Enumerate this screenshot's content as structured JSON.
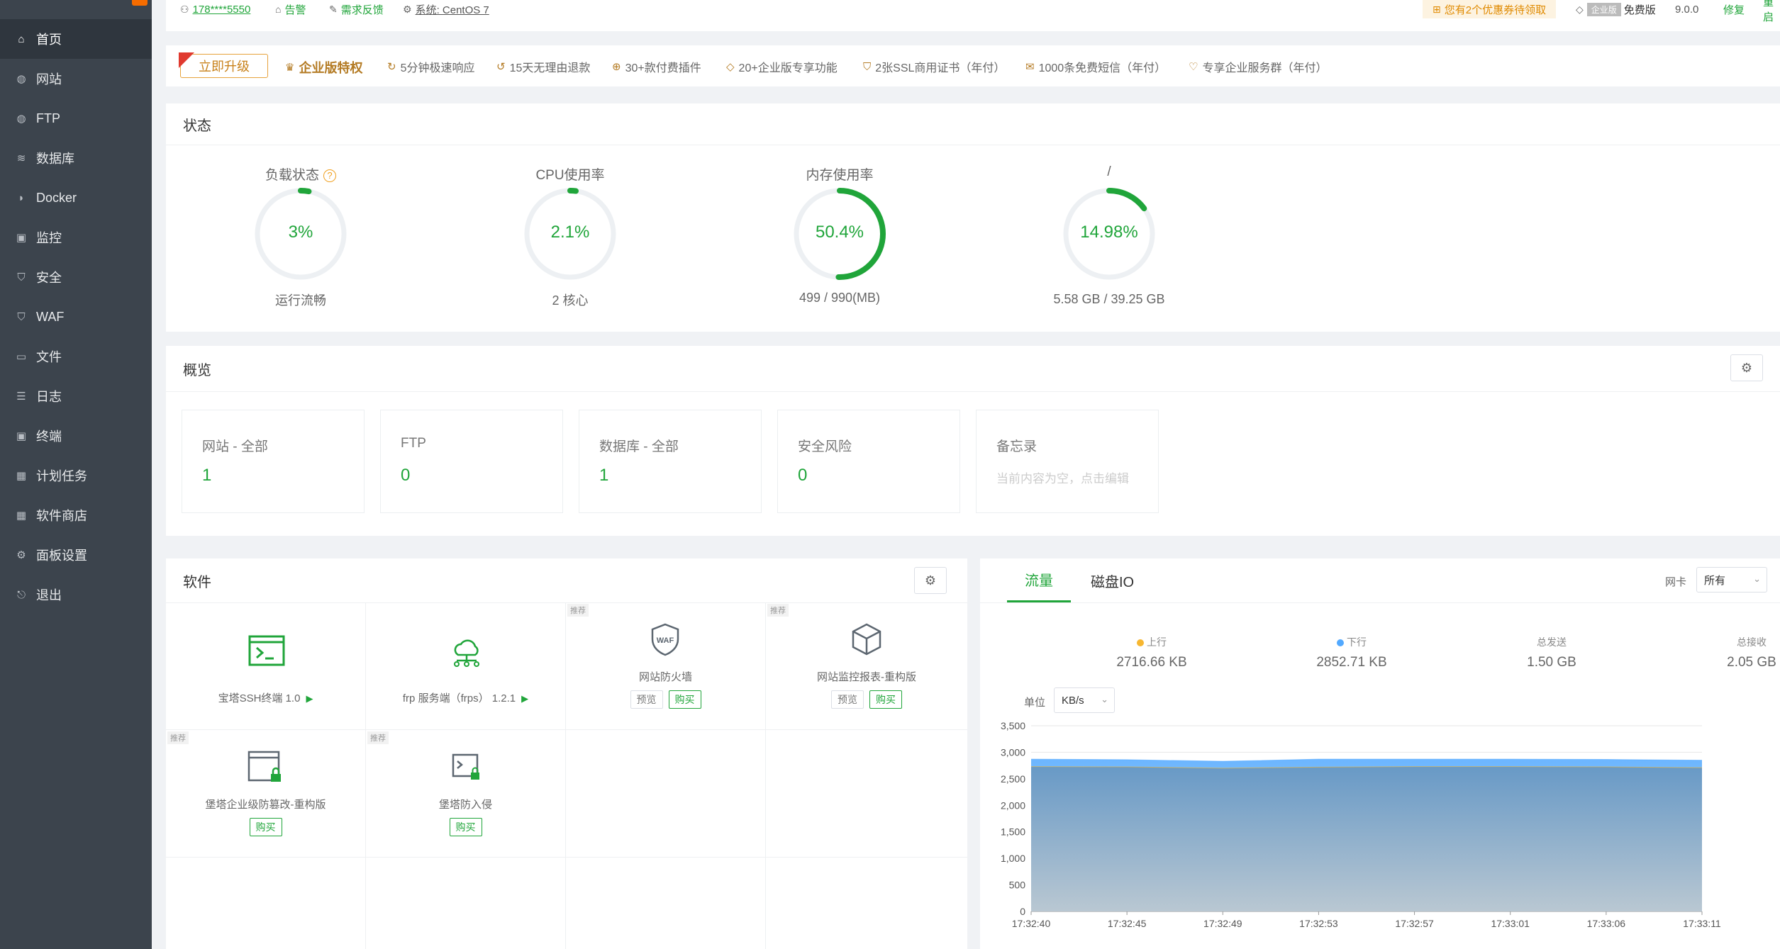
{
  "sidebar": {
    "items": [
      {
        "label": "首页",
        "icon": "home-icon",
        "glyph": "⌂",
        "active": true
      },
      {
        "label": "网站",
        "icon": "globe-icon",
        "glyph": "◍"
      },
      {
        "label": "FTP",
        "icon": "ftp-globe-icon",
        "glyph": "◍"
      },
      {
        "label": "数据库",
        "icon": "database-icon",
        "glyph": "≋"
      },
      {
        "label": "Docker",
        "icon": "docker-icon",
        "glyph": "◗"
      },
      {
        "label": "监控",
        "icon": "monitor-icon",
        "glyph": "▣"
      },
      {
        "label": "安全",
        "icon": "shield-icon",
        "glyph": "⛉"
      },
      {
        "label": "WAF",
        "icon": "waf-shield-icon",
        "glyph": "⛉"
      },
      {
        "label": "文件",
        "icon": "folder-icon",
        "glyph": "▭"
      },
      {
        "label": "日志",
        "icon": "log-icon",
        "glyph": "☰"
      },
      {
        "label": "终端",
        "icon": "terminal-icon",
        "glyph": "▣"
      },
      {
        "label": "计划任务",
        "icon": "calendar-icon",
        "glyph": "▦"
      },
      {
        "label": "软件商店",
        "icon": "apps-icon",
        "glyph": "▦"
      },
      {
        "label": "面板设置",
        "icon": "settings-icon",
        "glyph": "⚙"
      },
      {
        "label": "退出",
        "icon": "logout-icon",
        "glyph": "⎋"
      }
    ]
  },
  "topbar": {
    "phone": "178****5550",
    "alert": "告警",
    "feedback": "需求反馈",
    "system": "系统:  CentOS 7",
    "coupon": "您有2个优惠券待领取",
    "edition_badge": "企业版",
    "edition": "免费版",
    "version": "9.0.0",
    "repair": "修复",
    "restart": "重启"
  },
  "promo": {
    "upgrade": "立即升级",
    "title": "企业版特权",
    "features": [
      "5分钟极速响应",
      "15天无理由退款",
      "30+款付费插件",
      "20+企业版专享功能",
      "2张SSL商用证书（年付）",
      "1000条免费短信（年付）",
      "专享企业服务群（年付）"
    ]
  },
  "status": {
    "title": "状态",
    "gauges": [
      {
        "label": "负载状态",
        "value": "3%",
        "sub": "运行流畅",
        "percent": 0.03,
        "help": "?"
      },
      {
        "label": "CPU使用率",
        "value": "2.1%",
        "sub": "2 核心",
        "percent": 0.021
      },
      {
        "label": "内存使用率",
        "value": "50.4%",
        "sub": "499 / 990(MB)",
        "percent": 0.504
      },
      {
        "label": "/",
        "value": "14.98%",
        "sub": "5.58 GB / 39.25 GB",
        "percent": 0.1498
      }
    ]
  },
  "overview": {
    "title": "概览",
    "boxes": [
      {
        "label": "网站 - 全部",
        "value": "1"
      },
      {
        "label": "FTP",
        "value": "0"
      },
      {
        "label": "数据库 - 全部",
        "value": "1"
      },
      {
        "label": "安全风险",
        "value": "0"
      }
    ],
    "memo": {
      "label": "备忘录",
      "placeholder": "当前内容为空，点击编辑"
    }
  },
  "software": {
    "title": "软件",
    "tag": "推荐",
    "preview": "预览",
    "buy": "购买",
    "items": [
      {
        "name": "宝塔SSH终端 1.0"
      },
      {
        "name": "frp 服务端（frps） 1.2.1"
      },
      {
        "name": "网站防火墙"
      },
      {
        "name": "网站监控报表-重构版"
      },
      {
        "name": "堡塔企业级防篡改-重构版"
      },
      {
        "name": "堡塔防入侵"
      }
    ]
  },
  "traffic": {
    "tab_flow": "流量",
    "tab_disk": "磁盘IO",
    "nic_label": "网卡",
    "nic_value": "所有",
    "unit_label": "单位",
    "unit_value": "KB/s",
    "stats": [
      {
        "label": "上行",
        "value": "2716.66 KB",
        "color": "#f7b731"
      },
      {
        "label": "下行",
        "value": "2852.71 KB",
        "color": "#52a9ff"
      },
      {
        "label": "总发送",
        "value": "1.50 GB"
      },
      {
        "label": "总接收",
        "value": "2.05 GB"
      }
    ]
  },
  "chart_data": {
    "type": "area",
    "x": [
      "17:32:40",
      "17:32:45",
      "17:32:49",
      "17:32:53",
      "17:32:57",
      "17:33:01",
      "17:33:06",
      "17:33:11"
    ],
    "ylim": [
      0,
      3500
    ],
    "yticks": [
      "0",
      "500",
      "1,000",
      "1,500",
      "2,000",
      "2,500",
      "3,000",
      "3,500"
    ],
    "series": [
      {
        "name": "上行",
        "values": [
          2730,
          2725,
          2700,
          2720,
          2730,
          2730,
          2725,
          2710
        ]
      },
      {
        "name": "下行",
        "values": [
          2870,
          2860,
          2830,
          2870,
          2870,
          2870,
          2865,
          2850
        ]
      }
    ]
  }
}
